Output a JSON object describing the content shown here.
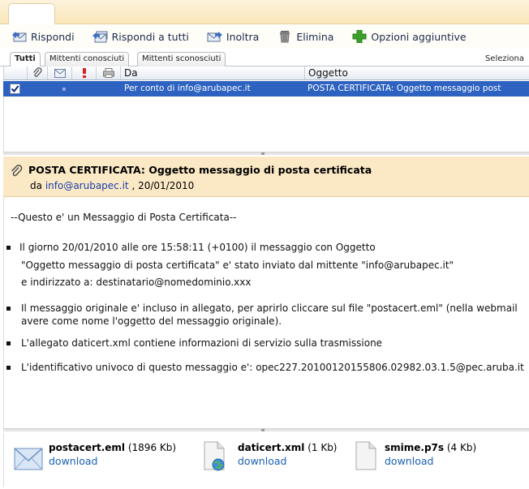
{
  "toolbar": {
    "reply": "Rispondi",
    "reply_all": "Rispondi a tutti",
    "forward": "Inoltra",
    "delete": "Elimina",
    "more": "Opzioni aggiuntive"
  },
  "filters": {
    "tabs": [
      "Tutti",
      "Mittenti conosciuti",
      "Mittenti sconosciuti"
    ],
    "active": "Tutti",
    "select_label": "Seleziona"
  },
  "grid": {
    "columns": {
      "from": "Da",
      "subject": "Oggetto"
    },
    "rows": [
      {
        "from": "Per conto di info@arubapec.it",
        "subject": "POSTA CERTIFICATA: Oggetto messaggio  post",
        "selected": true
      }
    ]
  },
  "message": {
    "subject": "POSTA CERTIFICATA:  Oggetto messaggio di posta certificata",
    "from_prefix": "da",
    "from_email": "info@arubapec.it",
    "date": ", 20/01/2010",
    "intro": "--Questo e' un Messaggio di Posta Certificata--",
    "b1_l1": "Il giorno 20/01/2010 alle ore 15:58:11 (+0100) il messaggio con Oggetto",
    "b1_l2": "\"Oggetto messaggio di posta certificata\" e' stato inviato dal mittente \"info@arubapec.it\"",
    "b1_l3": "e indirizzato a: destinatario@nomedominio.xxx",
    "b2_l1": "Il messaggio originale e' incluso in allegato, per aprirlo cliccare sul file \"postacert.eml\" (nella webmail",
    "b2_l2": "avere come nome l'oggetto del messaggio originale).",
    "b3": "L'allegato daticert.xml contiene informazioni di servizio sulla trasmissione",
    "b4": "L'identificativo univoco di questo messaggio e': opec227.20100120155806.02982.03.1.5@pec.aruba.it"
  },
  "attachments": [
    {
      "name": "postacert.eml",
      "size": "(1896 Kb)",
      "action": "download"
    },
    {
      "name": "daticert.xml",
      "size": "(1 Kb)",
      "action": "download"
    },
    {
      "name": "smime.p7s",
      "size": "(4 Kb)",
      "action": "download"
    }
  ],
  "colors": {
    "selection": "#2d62c1",
    "header_bg": "#fbe9c6",
    "link": "#1a5fb4",
    "toolbar_add": "#3aa02a"
  },
  "icons": [
    "reply-icon",
    "reply-all-icon",
    "forward-icon",
    "trash-icon",
    "plus-icon",
    "paperclip-icon",
    "envelope-icon",
    "priority-icon",
    "print-icon",
    "eml-file-icon",
    "xml-file-icon",
    "p7s-file-icon"
  ]
}
